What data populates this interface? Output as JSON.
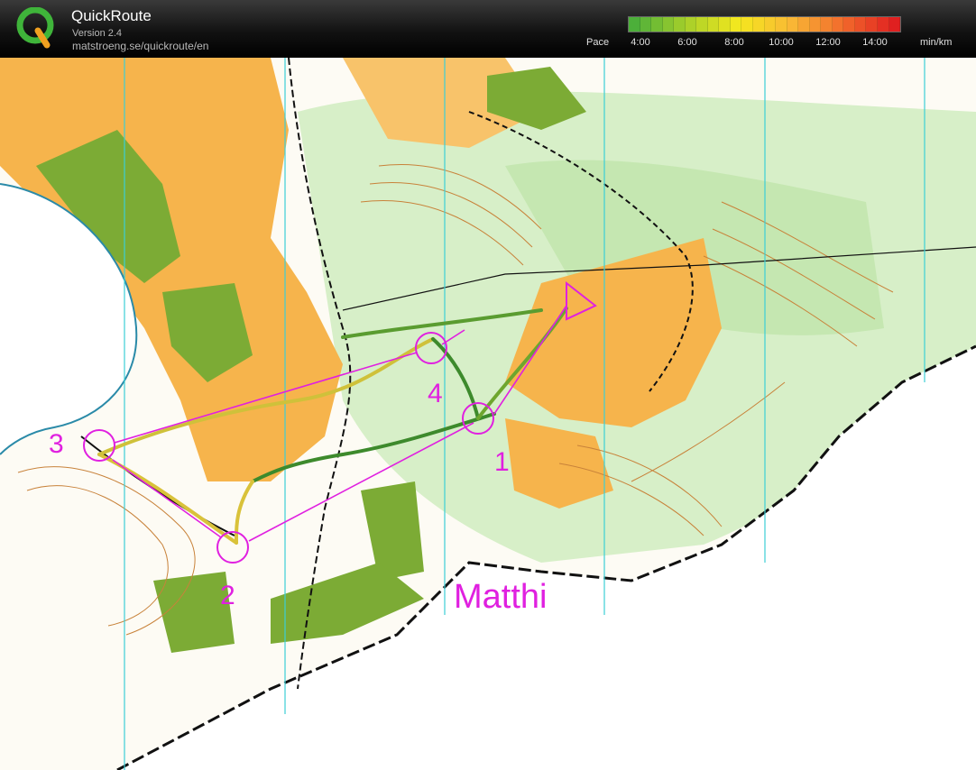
{
  "app": {
    "title": "QuickRoute",
    "version": "Version 2.4",
    "url": "matstroeng.se/quickroute/en"
  },
  "pace_legend": {
    "label": "Pace",
    "ticks": [
      "4:00",
      "6:00",
      "8:00",
      "10:00",
      "12:00",
      "14:00"
    ],
    "unit": "min/km",
    "colors": [
      "#4caf3a",
      "#a6cf2a",
      "#f4e81e",
      "#f9b935",
      "#f26b2c",
      "#e02020"
    ]
  },
  "map": {
    "runner_name": "Matthi",
    "controls": [
      "1",
      "2",
      "3",
      "4"
    ],
    "course_color": "#e020e0",
    "route_color_slow": "#d9c23a",
    "route_color_fast": "#3d8a2c"
  }
}
